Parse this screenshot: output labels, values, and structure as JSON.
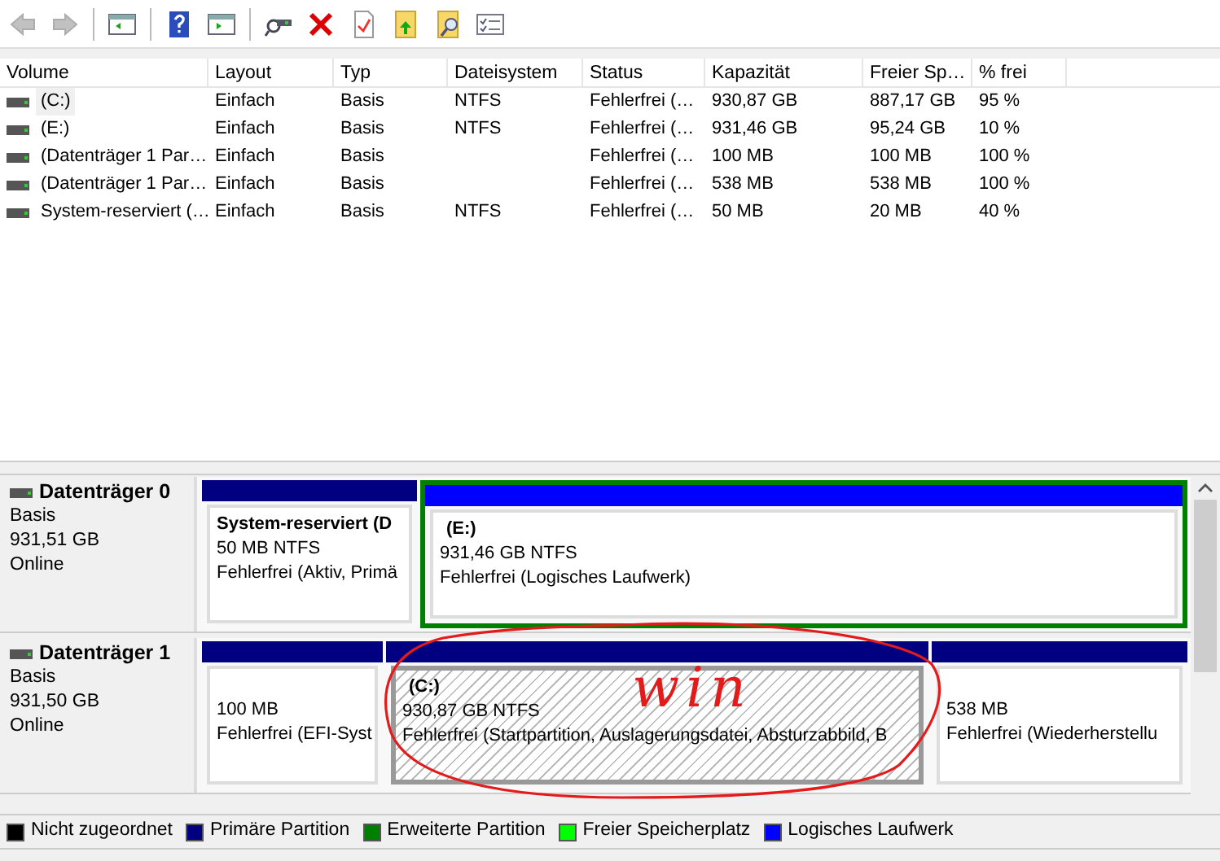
{
  "toolbar": {
    "buttons": [
      {
        "kind": "back",
        "disabled": true
      },
      {
        "kind": "forward",
        "disabled": true
      },
      {
        "kind": "tree",
        "disabled": false
      },
      {
        "kind": "help",
        "disabled": false
      },
      {
        "kind": "pane",
        "disabled": false
      },
      {
        "kind": "connect",
        "disabled": false
      },
      {
        "kind": "delete",
        "disabled": false
      },
      {
        "kind": "properties",
        "disabled": false
      },
      {
        "kind": "folderup",
        "disabled": false
      },
      {
        "kind": "search",
        "disabled": false
      },
      {
        "kind": "checklist",
        "disabled": false
      }
    ]
  },
  "table": {
    "columns": [
      "Volume",
      "Layout",
      "Typ",
      "Dateisystem",
      "Status",
      "Kapazität",
      "Freier Sp…",
      "% frei"
    ],
    "rows": [
      {
        "selected": true,
        "cells": [
          "(C:)",
          "Einfach",
          "Basis",
          "NTFS",
          "Fehlerfrei (…",
          "930,87 GB",
          "887,17 GB",
          "95 %"
        ]
      },
      {
        "selected": false,
        "cells": [
          "(E:)",
          "Einfach",
          "Basis",
          "NTFS",
          "Fehlerfrei (…",
          "931,46 GB",
          "95,24 GB",
          "10 %"
        ]
      },
      {
        "selected": false,
        "cells": [
          "(Datenträger 1 Par…",
          "Einfach",
          "Basis",
          "",
          "Fehlerfrei (…",
          "100 MB",
          "100 MB",
          "100 %"
        ]
      },
      {
        "selected": false,
        "cells": [
          "(Datenträger 1 Par…",
          "Einfach",
          "Basis",
          "",
          "Fehlerfrei (…",
          "538 MB",
          "538 MB",
          "100 %"
        ]
      },
      {
        "selected": false,
        "cells": [
          "System-reserviert (…",
          "Einfach",
          "Basis",
          "NTFS",
          "Fehlerfrei (…",
          "50 MB",
          "20 MB",
          "40 %"
        ]
      }
    ]
  },
  "disks": [
    {
      "name": "Datenträger 0",
      "type": "Basis",
      "size": "931,51 GB",
      "state": "Online",
      "partitions": [
        {
          "kind": "primary",
          "selected": false,
          "title": "System-reserviert (D",
          "size": "50 MB NTFS",
          "status": "Fehlerfrei (Aktiv, Primä"
        },
        {
          "kind": "logical",
          "selected": false,
          "title": "(E:)",
          "size": "931,46 GB NTFS",
          "status": "Fehlerfrei (Logisches Laufwerk)"
        }
      ]
    },
    {
      "name": "Datenträger 1",
      "type": "Basis",
      "size": "931,50 GB",
      "state": "Online",
      "partitions": [
        {
          "kind": "primary",
          "selected": false,
          "size": "100 MB",
          "status": "Fehlerfrei (EFI-Syst"
        },
        {
          "kind": "primary",
          "selected": true,
          "title": "(C:)",
          "size": "930,87 GB NTFS",
          "status": "Fehlerfrei (Startpartition, Auslagerungsdatei, Absturzabbild, B"
        },
        {
          "kind": "primary",
          "selected": false,
          "size": "538 MB",
          "status": "Fehlerfrei (Wiederherstellu"
        }
      ]
    }
  ],
  "legend": [
    {
      "label": "Nicht zugeordnet",
      "color": "#000000"
    },
    {
      "label": "Primäre Partition",
      "color": "#000080"
    },
    {
      "label": "Erweiterte Partition",
      "color": "#008000"
    },
    {
      "label": "Freier Speicherplatz",
      "color": "#00ff00"
    },
    {
      "label": "Logisches Laufwerk",
      "color": "#0000ff"
    }
  ],
  "annotation": {
    "text": "win"
  }
}
